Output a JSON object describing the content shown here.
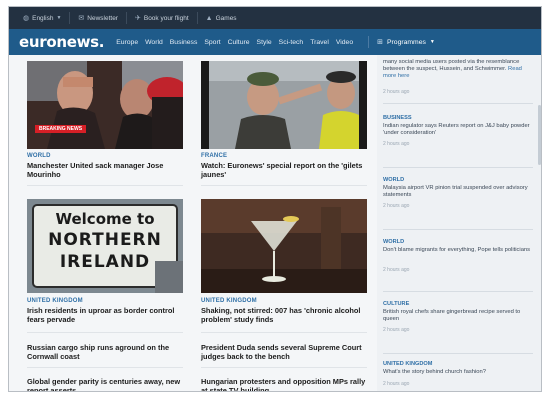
{
  "utilbar": {
    "language": "English",
    "newsletter": "Newsletter",
    "flight": "Book your flight",
    "games": "Games"
  },
  "nav": {
    "logo": "euronews.",
    "links": [
      "Europe",
      "World",
      "Business",
      "Sport",
      "Culture",
      "Style",
      "Sci-tech",
      "Travel",
      "Video"
    ],
    "programmes": "Programmes"
  },
  "articles": [
    {
      "category": "WORLD",
      "headline": "Manchester United sack manager Jose Mourinho",
      "badge": "BREAKING NEWS"
    },
    {
      "category": "FRANCE",
      "headline": "Watch: Euronews' special report on the 'gilets jaunes'"
    },
    {
      "category": "UNITED KINGDOM",
      "headline": "Irish residents in uproar as border control fears pervade",
      "sign": [
        "Welcome to",
        "NORTHERN",
        "IRELAND"
      ]
    },
    {
      "category": "UNITED KINGDOM",
      "headline": "Shaking, not stirred: 007 has 'chronic alcohol problem' study finds"
    },
    {
      "headline": "Russian cargo ship runs aground on the Cornwall coast"
    },
    {
      "headline": "President Duda sends several Supreme Court judges back to the bench"
    },
    {
      "headline": "Global gender parity is centuries away, new report asserts"
    },
    {
      "headline": "Hungarian protesters and opposition MPs rally at state TV building"
    }
  ],
  "sidebar": [
    {
      "text": "many social media users posted via the resemblance between the suspect, Hussein, and Schwimmer.",
      "readmore": "Read more here",
      "time": "2 hours ago"
    },
    {
      "category": "BUSINESS",
      "text": "Indian regulator says Reuters report on J&J baby powder 'under consideration'",
      "time": "2 hours ago"
    },
    {
      "category": "WORLD",
      "text": "Malaysia airport VR pinion trial suspended over advisory statements",
      "time": "2 hours ago"
    },
    {
      "category": "WORLD",
      "text": "Don't blame migrants for everything, Pope tells politicians",
      "time": "2 hours ago"
    },
    {
      "category": "CULTURE",
      "text": "British royal chefs share gingerbread recipe served to queen",
      "time": "2 hours ago"
    },
    {
      "category": "UNITED KINGDOM",
      "text": "What's the story behind church fashion?",
      "time": "2 hours ago"
    }
  ]
}
